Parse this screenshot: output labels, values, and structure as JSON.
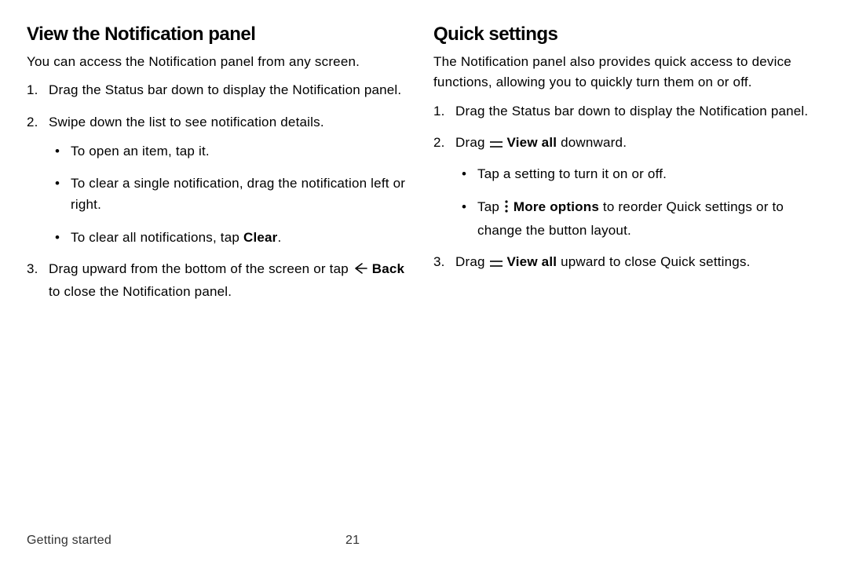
{
  "left": {
    "heading": "View the Notification panel",
    "intro": "You can access the Notification panel from any screen.",
    "step1": "Drag the Status bar down to display the Notification panel.",
    "step2": "Swipe down the list to see notification details.",
    "sub2a": "To open an item, tap it.",
    "sub2b": "To clear a single notification, drag the notification left or right.",
    "sub2c_pre": "To clear all notifications, tap ",
    "sub2c_bold": "Clear",
    "sub2c_post": ".",
    "step3_pre": "Drag upward from the bottom of the screen or tap ",
    "step3_bold": "Back",
    "step3_post": " to close the Notification panel."
  },
  "right": {
    "heading": "Quick settings",
    "intro": "The Notification panel also provides quick access to device functions, allowing you to quickly turn them on or off.",
    "step1": "Drag the Status bar down to display the Notification panel.",
    "step2_pre": "Drag ",
    "step2_bold": "View all",
    "step2_post": " downward.",
    "sub2a": "Tap a setting to turn it on or off.",
    "sub2b_pre": "Tap ",
    "sub2b_bold": "More options",
    "sub2b_post": " to reorder Quick settings or to change the button layout.",
    "step3_pre": "Drag ",
    "step3_bold": "View all",
    "step3_post": " upward to close Quick settings."
  },
  "footer": {
    "section": "Getting started",
    "page": "21"
  }
}
